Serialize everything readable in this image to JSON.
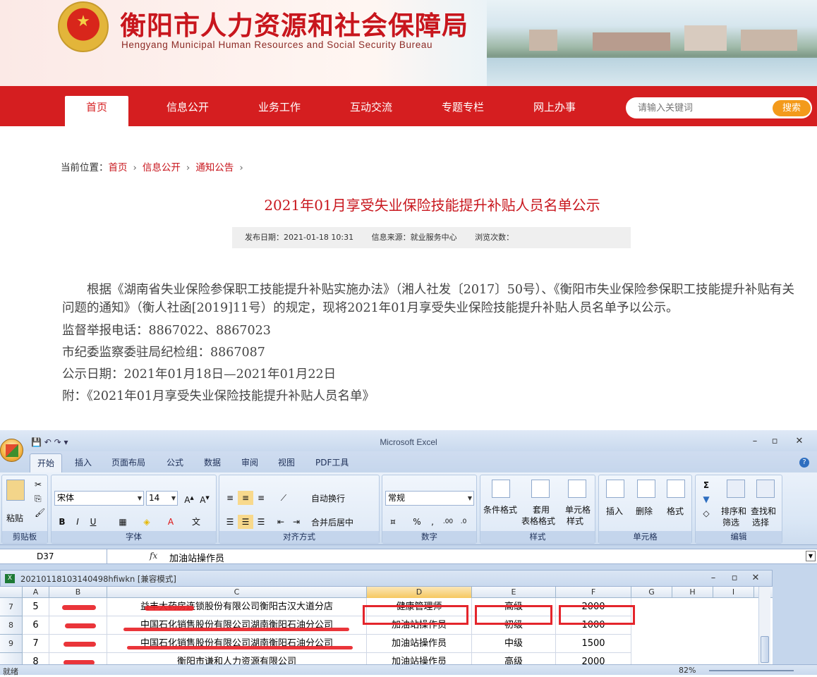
{
  "header": {
    "title_cn": "衡阳市人力资源和社会保障局",
    "title_en": "Hengyang Municipal Human Resources and Social Security Bureau"
  },
  "nav": {
    "items": [
      "首页",
      "信息公开",
      "业务工作",
      "互动交流",
      "专题专栏",
      "网上办事"
    ],
    "active": "首页"
  },
  "search": {
    "placeholder": "请输入关键词",
    "button": "搜索"
  },
  "breadcrumb": {
    "prefix": "当前位置：",
    "items": [
      "首页",
      "信息公开",
      "通知公告"
    ],
    "sep": "›"
  },
  "article": {
    "title": "2021年01月享受失业保险技能提升补贴人员名单公示",
    "meta": {
      "date": "发布日期：2021-01-18 10:31",
      "source": "信息来源：就业服务中心",
      "views": "浏览次数："
    },
    "paragraph": "根据《湖南省失业保险参保职工技能提升补贴实施办法》（湘人社发〔2017〕50号）、《衡阳市失业保险参保职工技能提升补贴有关问题的通知》（衡人社函[2019]11号）的规定，现将2021年01月享受失业保险技能提升补贴人员名单予以公示。",
    "lines": [
      "监督举报电话：8867022、8867023",
      "市纪委监察委驻局纪检组：8867087",
      "公示日期：2021年01月18日—2021年01月22日",
      "附：《2021年01月享受失业保险技能提升补贴人员名单》"
    ]
  },
  "excel": {
    "qat": "▾",
    "window_title": "Microsoft Excel",
    "win_buttons": [
      "–",
      "▫",
      "✕"
    ],
    "tabs": [
      "开始",
      "插入",
      "页面布局",
      "公式",
      "数据",
      "审阅",
      "视图",
      "PDF工具"
    ],
    "active_tab": "开始",
    "groups": {
      "clipboard": {
        "label": "剪贴板",
        "paste": "粘贴"
      },
      "font": {
        "label": "字体",
        "name": "宋体",
        "size": "14"
      },
      "align": {
        "label": "对齐方式",
        "wrap": "自动换行",
        "merge": "合并后居中"
      },
      "number": {
        "label": "数字",
        "format": "常规"
      },
      "styles": {
        "label": "样式",
        "cond": "条件格式",
        "table1": "套用",
        "table2": "表格格式",
        "cell1": "单元格",
        "cell2": "样式"
      },
      "cells": {
        "label": "单元格",
        "insert": "插入",
        "delete": "删除",
        "format": "格式"
      },
      "edit": {
        "label": "编辑",
        "sort1": "排序和",
        "sort2": "筛选",
        "find1": "查找和",
        "find2": "选择"
      }
    },
    "name_box": "D37",
    "formula": "加油站操作员",
    "workbook_title": "20210118103140498hfiwkn  [兼容模式]",
    "columns": [
      "A",
      "B",
      "C",
      "D",
      "E",
      "F",
      "G",
      "H",
      "I"
    ],
    "selected_column": "D",
    "rows": [
      {
        "row": "7",
        "cells": [
          "5",
          "",
          "益丰大药房连锁股份有限公司衡阳古汉大道分店",
          "健康管理师",
          "高级",
          "2000"
        ]
      },
      {
        "row": "8",
        "cells": [
          "6",
          "",
          "中国石化销售股份有限公司湖南衡阳石油分公司",
          "加油站操作员",
          "初级",
          "1000"
        ]
      },
      {
        "row": "9",
        "cells": [
          "7",
          "",
          "中国石化销售股份有限公司湖南衡阳石油分公司",
          "加油站操作员",
          "中级",
          "1500"
        ]
      },
      {
        "row": "",
        "cells": [
          "8",
          "",
          "衡阳市谦和人力资源有限公司",
          "加油站操作员",
          "高级",
          "2000"
        ]
      }
    ],
    "status": "就绪",
    "zoom": "82%"
  }
}
